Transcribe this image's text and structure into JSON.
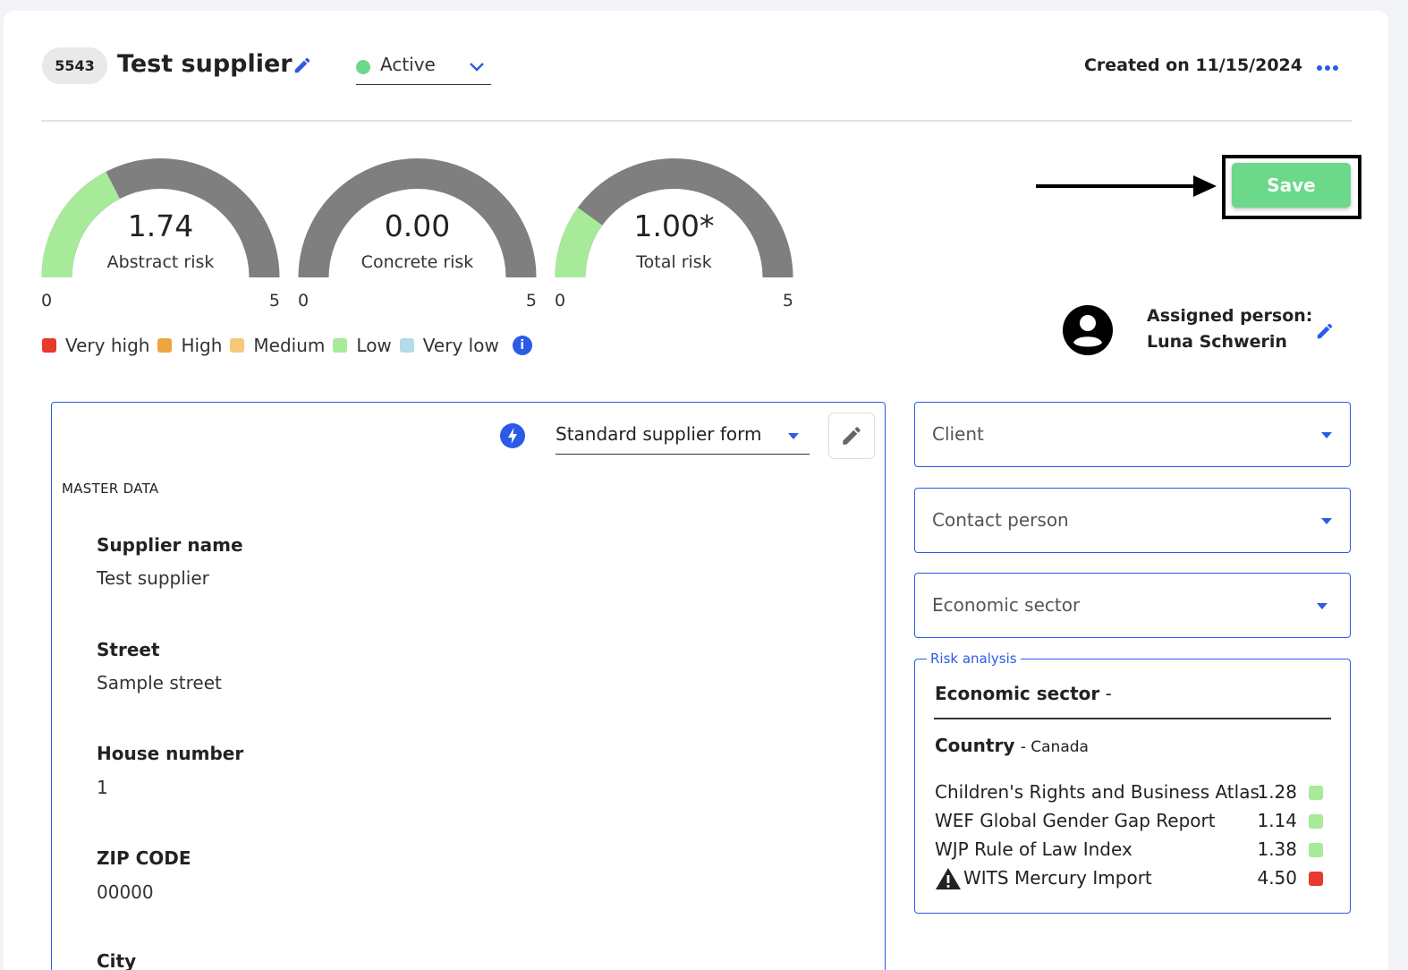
{
  "header": {
    "id_badge": "5543",
    "title": "Test supplier",
    "status": {
      "label": "Active",
      "color": "#6bd88a"
    },
    "created": "Created on 11/15/2024"
  },
  "gauges": [
    {
      "value": 1.74,
      "value_text": "1.74",
      "label": "Abstract risk",
      "min": "0",
      "max": "5"
    },
    {
      "value": 0.0,
      "value_text": "0.00",
      "label": "Concrete risk",
      "min": "0",
      "max": "5"
    },
    {
      "value": 1.0,
      "value_text": "1.00*",
      "label": "Total risk",
      "min": "0",
      "max": "5"
    }
  ],
  "legend": [
    {
      "label": "Very high",
      "color": "#e53a2c"
    },
    {
      "label": "High",
      "color": "#f0a441"
    },
    {
      "label": "Medium",
      "color": "#f5c97a"
    },
    {
      "label": "Low",
      "color": "#a6ea9a"
    },
    {
      "label": "Very low",
      "color": "#b5dbe8"
    }
  ],
  "toolbar": {
    "save_label": "Save"
  },
  "assigned": {
    "title": "Assigned person:",
    "name": "Luna Schwerin"
  },
  "form": {
    "selected_form": "Standard supplier form",
    "section": "MASTER DATA",
    "fields": [
      {
        "label": "Supplier name",
        "value": "Test supplier"
      },
      {
        "label": "Street",
        "value": "Sample street"
      },
      {
        "label": "House number",
        "value": "1"
      },
      {
        "label": "ZIP CODE",
        "value": "00000"
      },
      {
        "label": "City",
        "value": ""
      }
    ]
  },
  "dropdowns": {
    "client": "Client",
    "contact": "Contact person",
    "sector": "Economic sector"
  },
  "risk_analysis": {
    "legend": "Risk analysis",
    "sector_label": "Economic sector",
    "sector_value": "-",
    "country_label": "Country",
    "country_value": "- Canada",
    "indices": [
      {
        "name": "Children's Rights and Business Atlas",
        "value": "1.28",
        "color": "#a6ea9a",
        "warning": false
      },
      {
        "name": "WEF Global Gender Gap Report",
        "value": "1.14",
        "color": "#a6ea9a",
        "warning": false
      },
      {
        "name": "WJP Rule of Law Index",
        "value": "1.38",
        "color": "#a6ea9a",
        "warning": false
      },
      {
        "name": "WITS Mercury Import",
        "value": "4.50",
        "color": "#e53a2c",
        "warning": true
      }
    ]
  }
}
